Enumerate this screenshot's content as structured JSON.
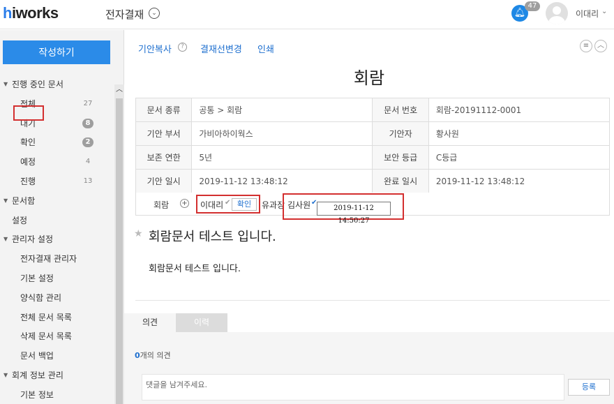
{
  "header": {
    "logo_h": "h",
    "logo_rest": "iworks",
    "app_title": "전자결재",
    "notification_count": "47",
    "username": "이대리"
  },
  "sidebar": {
    "write_button": "작성하기",
    "items": [
      {
        "label": "진행 중인 문서",
        "type": "section"
      },
      {
        "label": "전체",
        "count": "27",
        "type": "sub"
      },
      {
        "label": "대기",
        "count": "8",
        "type": "sub",
        "pill": true
      },
      {
        "label": "확인",
        "count": "2",
        "type": "sub",
        "pill": true
      },
      {
        "label": "예정",
        "count": "4",
        "type": "sub"
      },
      {
        "label": "진행",
        "count": "13",
        "type": "sub"
      },
      {
        "label": "문서함",
        "type": "section"
      },
      {
        "label": "설정",
        "type": "plain"
      },
      {
        "label": "관리자 설정",
        "type": "section"
      },
      {
        "label": "전자결재 관리자",
        "type": "sub"
      },
      {
        "label": "기본 설정",
        "type": "sub"
      },
      {
        "label": "양식함 관리",
        "type": "sub"
      },
      {
        "label": "전체 문서 목록",
        "type": "sub"
      },
      {
        "label": "삭제 문서 목록",
        "type": "sub"
      },
      {
        "label": "문서 백업",
        "type": "sub"
      },
      {
        "label": "회계 정보 관리",
        "type": "section"
      },
      {
        "label": "기본 정보",
        "type": "sub"
      }
    ]
  },
  "toolbar": {
    "copy_draft": "기안복사",
    "change_line": "결재선변경",
    "print": "인쇄"
  },
  "document": {
    "title": "회람",
    "rows": [
      {
        "k1": "문서 종류",
        "v1": "공통 > 회람",
        "k2": "문서 번호",
        "v2": "회람-20191112-0001"
      },
      {
        "k1": "기안 부서",
        "v1": "가비아하이웍스",
        "k2": "기안자",
        "v2": "황사원"
      },
      {
        "k1": "보존 연한",
        "v1": "5년",
        "k2": "보안 등급",
        "v2": "C등급"
      },
      {
        "k1": "기안 일시",
        "v1": "2019-11-12 13:48:12",
        "k2": "완료 일시",
        "v2": "2019-11-12 13:48:12"
      }
    ],
    "review_label": "회람",
    "reviewers": [
      "이대리",
      "유과장",
      "김사원"
    ],
    "confirm_button": "확인",
    "timestamp": "2019-11-12 14:50:27",
    "heading": "회람문서 테스트 입니다.",
    "body": "회람문서 테스트 입니다."
  },
  "comments": {
    "tab_opinion": "의견",
    "tab_history": "이력",
    "count_number": "0",
    "count_suffix": "개의 의견",
    "placeholder": "댓글을 남겨주세요.",
    "register_button": "등록"
  }
}
